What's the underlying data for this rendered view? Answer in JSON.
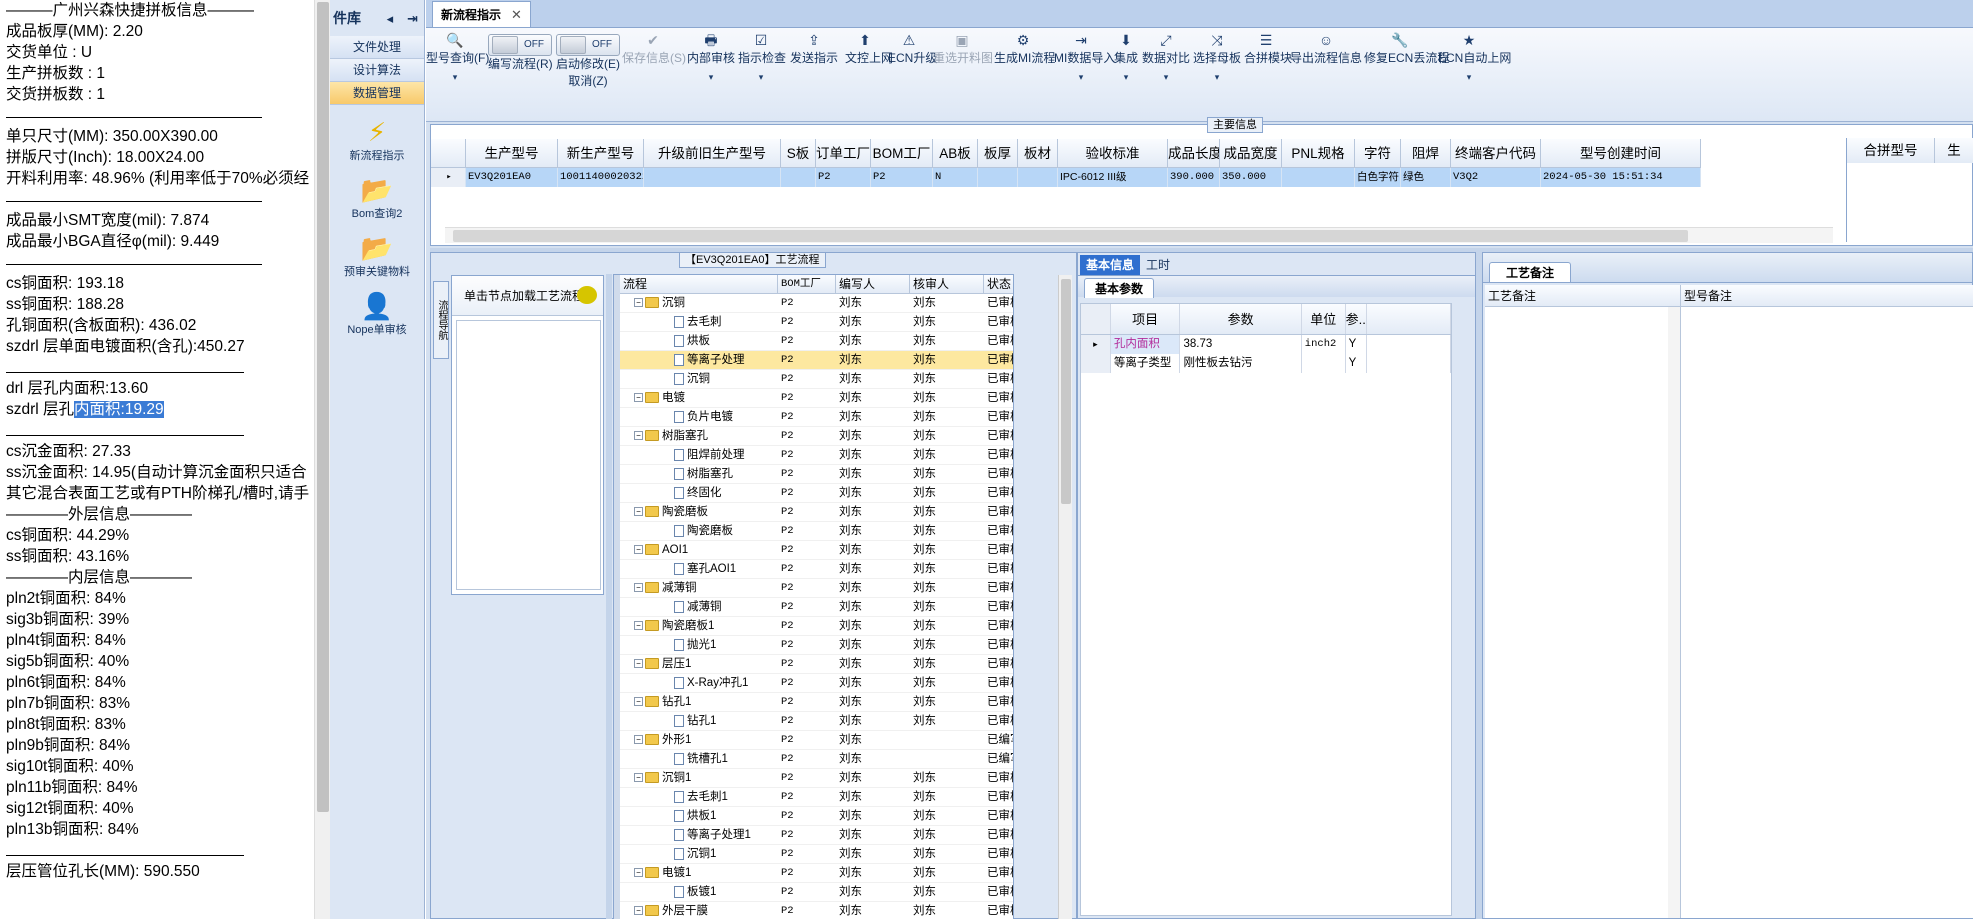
{
  "info_pane": {
    "lines": [
      {
        "text": "———广州兴森快捷拼板信息———",
        "kind": "hdr"
      },
      {
        "text": "成品板厚(MM): 2.20"
      },
      {
        "text": "交货单位 : U"
      },
      {
        "text": "生产拼板数 : 1"
      },
      {
        "text": "交货拼板数 : 1"
      },
      {
        "text": "",
        "kind": "sep"
      },
      {
        "text": "单只尺寸(MM): 350.00X390.00"
      },
      {
        "text": "拼版尺寸(Inch): 18.00X24.00"
      },
      {
        "text": "开料利用率: 48.96% (利用率低于70%必须经"
      },
      {
        "text": "",
        "kind": "sep"
      },
      {
        "text": "成品最小SMT宽度(mil): 7.874"
      },
      {
        "text": "成品最小BGA直径φ(mil):  9.449"
      },
      {
        "text": "",
        "kind": "sep"
      },
      {
        "text": "cs铜面积: 193.18"
      },
      {
        "text": "ss铜面积: 188.28"
      },
      {
        "text": "孔铜面积(含板面积): 436.02"
      },
      {
        "text": "szdrl          层单面电镀面积(含孔):450.27"
      },
      {
        "text": "",
        "kind": "sep2"
      },
      {
        "text": "drl            层孔内面积:13.60"
      },
      {
        "text": "szdrl          层孔",
        "highlight": "内面积:19.29"
      },
      {
        "text": "",
        "kind": "sep2"
      },
      {
        "text": "cs沉金面积: 27.33"
      },
      {
        "text": "ss沉金面积: 14.95(自动计算沉金面积只适合"
      },
      {
        "text": "其它混合表面工艺或有PTH阶梯孔/槽时,请手"
      },
      {
        "text": "————外层信息————",
        "kind": "hdr"
      },
      {
        "text": "cs铜面积: 44.29%"
      },
      {
        "text": "ss铜面积: 43.16%"
      },
      {
        "text": "————内层信息————",
        "kind": "hdr"
      },
      {
        "text": "pln2t铜面积: 84%"
      },
      {
        "text": "sig3b铜面积: 39%"
      },
      {
        "text": "pln4t铜面积: 84%"
      },
      {
        "text": "sig5b铜面积: 40%"
      },
      {
        "text": "pln6t铜面积: 84%"
      },
      {
        "text": "pln7b铜面积: 83%"
      },
      {
        "text": "pln8t铜面积: 83%"
      },
      {
        "text": "pln9b铜面积: 84%"
      },
      {
        "text": "sig10t铜面积: 40%"
      },
      {
        "text": "pln11b铜面积: 84%"
      },
      {
        "text": "sig12t铜面积: 40%"
      },
      {
        "text": "pln13b铜面积: 84%"
      },
      {
        "text": "",
        "kind": "sep2"
      },
      {
        "text": "层压管位孔长(MM): 590.550"
      }
    ]
  },
  "nav": {
    "title": "件库",
    "icons": [
      "collapse-icon",
      "pin-icon"
    ],
    "modules": [
      "文件处理",
      "设计算法",
      "数据管理"
    ],
    "active_module": "数据管理",
    "tools": [
      {
        "label": "新流程指示",
        "icon": "lightning-icon",
        "glyph": "⚡",
        "color": "#e8b400"
      },
      {
        "label": "Bom查询2",
        "icon": "folder-icon",
        "glyph": "📂",
        "color": "#e8b400"
      },
      {
        "label": "预审关键物料",
        "icon": "folder-icon",
        "glyph": "📂",
        "color": "#e8b400"
      },
      {
        "label": "Nope单审核",
        "icon": "user-icon",
        "glyph": "👤",
        "color": "#2f8f2f"
      }
    ]
  },
  "tabs": [
    {
      "label": "新流程指示",
      "close": "✕"
    }
  ],
  "toolbar": {
    "items": [
      {
        "label": "型号查询(F)",
        "glyph": "🔍",
        "dd": "▾"
      },
      {
        "label": "编写流程(R)",
        "toggle": "OFF"
      },
      {
        "label": "启动修改(E)",
        "label2": "取消(Z)",
        "toggle": "OFF"
      },
      {
        "label": "保存信息(S)",
        "glyph": "✔",
        "disabled": true
      },
      {
        "label": "内部审核",
        "glyph": "🖶",
        "dd": "▾"
      },
      {
        "label": "指示检查",
        "glyph": "☑",
        "dd": "▾"
      },
      {
        "label": "发送指示",
        "glyph": "⇪"
      },
      {
        "label": "文控上网",
        "glyph": "⬆"
      },
      {
        "label": "ECN升级",
        "glyph": "⚠"
      },
      {
        "label": "重选开料图",
        "glyph": "▣",
        "disabled": true
      },
      {
        "label": "生成MI流程",
        "glyph": "⚙"
      },
      {
        "label": "MI数据导入",
        "glyph": "⇥",
        "dd": "▾"
      },
      {
        "label": "集成",
        "glyph": "⬇",
        "dd": "▾"
      },
      {
        "label": "数据对比",
        "glyph": "⤢",
        "dd": "▾"
      },
      {
        "label": "选择母板",
        "glyph": "⤨",
        "dd": "▾"
      },
      {
        "label": "合拼模块",
        "glyph": "☰"
      },
      {
        "label": "导出流程信息",
        "glyph": "☺"
      },
      {
        "label": "修复ECN丢流程",
        "glyph": "🔧"
      },
      {
        "label": "ECN自动上网",
        "glyph": "★",
        "dd": "▾"
      }
    ]
  },
  "main_info": {
    "caption": "主要信息",
    "columns": [
      "生产型号",
      "新生产型号",
      "升级前旧生产型号",
      "S板",
      "订单工厂",
      "BOM工厂",
      "AB板",
      "板厚",
      "板材",
      "验收标准",
      "成品长度",
      "成品宽度",
      "PNL规格",
      "字符",
      "阻焊",
      "终端客户代码",
      "型号创建时间"
    ],
    "row": [
      "EV3Q201EA0",
      "10011400020322",
      "",
      "",
      "P2",
      "P2",
      "N",
      "",
      "",
      "IPC-6012 III级",
      "390.000",
      "350.000",
      "",
      "白色字符",
      "绿色",
      "V3Q2",
      "2024-05-30 15:51:34"
    ],
    "right_columns": [
      "合拼型号",
      "生"
    ]
  },
  "process": {
    "caption": "【EV3Q201EA0】工艺流程",
    "side_tab": "流程导航",
    "load_hint": "单击节点加载工艺流程",
    "columns": [
      "流程",
      "BOM工厂",
      "编写人",
      "核审人",
      "状态"
    ],
    "rows": [
      {
        "name": "沉铜",
        "level": 0,
        "factory": "P2",
        "writer": "刘东",
        "reviewer": "刘东",
        "status": "已审核"
      },
      {
        "name": "去毛刺",
        "level": 1,
        "factory": "P2",
        "writer": "刘东",
        "reviewer": "刘东",
        "status": "已审核"
      },
      {
        "name": "烘板",
        "level": 1,
        "factory": "P2",
        "writer": "刘东",
        "reviewer": "刘东",
        "status": "已审核"
      },
      {
        "name": "等离子处理",
        "level": 1,
        "factory": "P2",
        "writer": "刘东",
        "reviewer": "刘东",
        "status": "已审核",
        "selected": true
      },
      {
        "name": "沉铜",
        "level": 1,
        "factory": "P2",
        "writer": "刘东",
        "reviewer": "刘东",
        "status": "已审核"
      },
      {
        "name": "电镀",
        "level": 0,
        "factory": "P2",
        "writer": "刘东",
        "reviewer": "刘东",
        "status": "已审核"
      },
      {
        "name": "负片电镀",
        "level": 1,
        "factory": "P2",
        "writer": "刘东",
        "reviewer": "刘东",
        "status": "已审核"
      },
      {
        "name": "树脂塞孔",
        "level": 0,
        "factory": "P2",
        "writer": "刘东",
        "reviewer": "刘东",
        "status": "已审核"
      },
      {
        "name": "阻焊前处理",
        "level": 1,
        "factory": "P2",
        "writer": "刘东",
        "reviewer": "刘东",
        "status": "已审核"
      },
      {
        "name": "树脂塞孔",
        "level": 1,
        "factory": "P2",
        "writer": "刘东",
        "reviewer": "刘东",
        "status": "已审核"
      },
      {
        "name": "终固化",
        "level": 1,
        "factory": "P2",
        "writer": "刘东",
        "reviewer": "刘东",
        "status": "已审核"
      },
      {
        "name": "陶瓷磨板",
        "level": 0,
        "factory": "P2",
        "writer": "刘东",
        "reviewer": "刘东",
        "status": "已审核"
      },
      {
        "name": "陶瓷磨板",
        "level": 1,
        "factory": "P2",
        "writer": "刘东",
        "reviewer": "刘东",
        "status": "已审核"
      },
      {
        "name": "AOI1",
        "level": 0,
        "factory": "P2",
        "writer": "刘东",
        "reviewer": "刘东",
        "status": "已审核"
      },
      {
        "name": "塞孔AOI1",
        "level": 1,
        "factory": "P2",
        "writer": "刘东",
        "reviewer": "刘东",
        "status": "已审核"
      },
      {
        "name": "减薄铜",
        "level": 0,
        "factory": "P2",
        "writer": "刘东",
        "reviewer": "刘东",
        "status": "已审核"
      },
      {
        "name": "减薄铜",
        "level": 1,
        "factory": "P2",
        "writer": "刘东",
        "reviewer": "刘东",
        "status": "已审核"
      },
      {
        "name": "陶瓷磨板1",
        "level": 0,
        "factory": "P2",
        "writer": "刘东",
        "reviewer": "刘东",
        "status": "已审核"
      },
      {
        "name": "抛光1",
        "level": 1,
        "factory": "P2",
        "writer": "刘东",
        "reviewer": "刘东",
        "status": "已审核"
      },
      {
        "name": "层压1",
        "level": 0,
        "factory": "P2",
        "writer": "刘东",
        "reviewer": "刘东",
        "status": "已审核"
      },
      {
        "name": "X-Ray冲孔1",
        "level": 1,
        "factory": "P2",
        "writer": "刘东",
        "reviewer": "刘东",
        "status": "已审核"
      },
      {
        "name": "钻孔1",
        "level": 0,
        "factory": "P2",
        "writer": "刘东",
        "reviewer": "刘东",
        "status": "已审核"
      },
      {
        "name": "钻孔1",
        "level": 1,
        "factory": "P2",
        "writer": "刘东",
        "reviewer": "刘东",
        "status": "已审核"
      },
      {
        "name": "外形1",
        "level": 0,
        "factory": "P2",
        "writer": "刘东",
        "reviewer": "",
        "status": "已编写"
      },
      {
        "name": "铣槽孔1",
        "level": 1,
        "factory": "P2",
        "writer": "刘东",
        "reviewer": "",
        "status": "已编写"
      },
      {
        "name": "沉铜1",
        "level": 0,
        "factory": "P2",
        "writer": "刘东",
        "reviewer": "刘东",
        "status": "已审核"
      },
      {
        "name": "去毛刺1",
        "level": 1,
        "factory": "P2",
        "writer": "刘东",
        "reviewer": "刘东",
        "status": "已审核"
      },
      {
        "name": "烘板1",
        "level": 1,
        "factory": "P2",
        "writer": "刘东",
        "reviewer": "刘东",
        "status": "已审核"
      },
      {
        "name": "等离子处理1",
        "level": 1,
        "factory": "P2",
        "writer": "刘东",
        "reviewer": "刘东",
        "status": "已审核"
      },
      {
        "name": "沉铜1",
        "level": 1,
        "factory": "P2",
        "writer": "刘东",
        "reviewer": "刘东",
        "status": "已审核"
      },
      {
        "name": "电镀1",
        "level": 0,
        "factory": "P2",
        "writer": "刘东",
        "reviewer": "刘东",
        "status": "已审核"
      },
      {
        "name": "板镀1",
        "level": 1,
        "factory": "P2",
        "writer": "刘东",
        "reviewer": "刘东",
        "status": "已审核"
      },
      {
        "name": "外层干膜",
        "level": 0,
        "factory": "P2",
        "writer": "刘东",
        "reviewer": "刘东",
        "status": "已审核"
      }
    ]
  },
  "params": {
    "tabs": [
      "基本信息",
      "工时"
    ],
    "active_tab": "基本信息",
    "sub_tab": "基本参数",
    "columns": [
      "项目",
      "参数",
      "单位",
      "参..."
    ],
    "rows": [
      {
        "item": "孔内面积",
        "value": "38.73",
        "unit": "inch2",
        "flag": "Y"
      },
      {
        "item": "等离子类型",
        "value": "刚性板去钻污",
        "unit": "",
        "flag": "Y"
      }
    ]
  },
  "remarks": {
    "sub_tab": "工艺备注",
    "columns": [
      "工艺备注",
      "型号备注"
    ]
  }
}
